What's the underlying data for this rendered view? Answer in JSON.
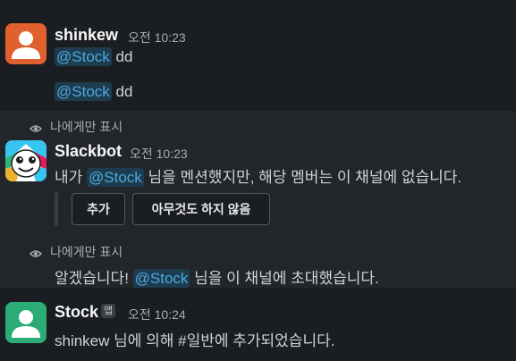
{
  "messages": [
    {
      "author": "shinkew",
      "time": "오전 10:23",
      "lines": [
        {
          "mention": "@Stock",
          "text": "dd"
        },
        {
          "mention": "@Stock",
          "text": "dd"
        }
      ]
    },
    {
      "ephemeral_label": "나에게만 표시",
      "author": "Slackbot",
      "time": "오전 10:23",
      "before": "내가 ",
      "mention": "@Stock",
      "after": " 님을 멘션했지만, 해당 멤버는 이 채널에 없습니다.",
      "buttons": {
        "add": "추가",
        "nothing": "아무것도 하지 않음"
      }
    },
    {
      "ephemeral_label": "나에게만 표시",
      "before": "알겠습니다! ",
      "mention": "@Stock",
      "after": " 님을 이 채널에 초대했습니다."
    },
    {
      "author": "Stock",
      "badge": "앱",
      "time": "오전 10:24",
      "text": "shinkew 님에 의해 #일반에 추가되었습니다."
    }
  ],
  "colors": {
    "background": "#1a1d21",
    "highlight": "#222529",
    "mention_bg": "#1d3c4d",
    "mention_fg": "#4fa8e0",
    "shinkew_avatar": "#e0612e",
    "stock_avatar": "#2bac76"
  },
  "icons": {
    "eye": "eye-icon",
    "person": "person-avatar-icon",
    "slackbot": "slackbot-logo-icon"
  }
}
